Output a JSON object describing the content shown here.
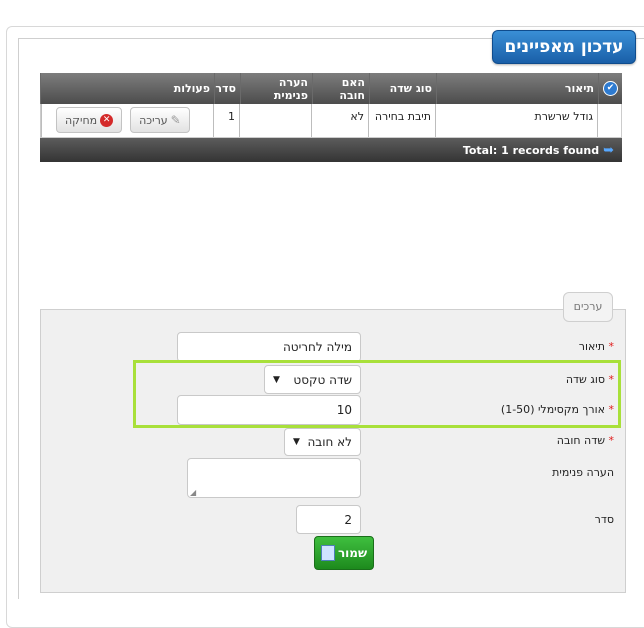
{
  "page_title": "עדכון מאפיינים",
  "grid": {
    "headers": {
      "description": "תיאור",
      "field_type": "סוג שדה",
      "required": "האם חובה",
      "internal_note": "הערה פנימית",
      "order": "סדר",
      "actions": "פעולות"
    },
    "rows": [
      {
        "description": "גודל שרשרת",
        "field_type": "תיבת בחירה",
        "required": "לא",
        "internal_note": "",
        "order": "1",
        "edit_label": "עריכה",
        "delete_label": "מחיקה"
      }
    ],
    "footer_total": "Total: 1 records found"
  },
  "form": {
    "tab_label": "ערכים",
    "description": {
      "label": "תיאור",
      "value": "מילה לחריטה"
    },
    "field_type": {
      "label": "סוג שדה",
      "value": "שדה טקסט"
    },
    "max_length": {
      "label": "אורך מקסימלי (1-50)",
      "value": "10"
    },
    "required": {
      "label": "שדה חובה",
      "value": "לא חובה"
    },
    "internal_note": {
      "label": "הערה פנימית",
      "value": ""
    },
    "order": {
      "label": "סדר",
      "value": "2"
    },
    "required_mark": "*",
    "save_label": "שמור"
  },
  "colors": {
    "highlight": "#a8e03a",
    "title_bg": "#1a5fa8",
    "save_bg": "#1d8a1d"
  }
}
